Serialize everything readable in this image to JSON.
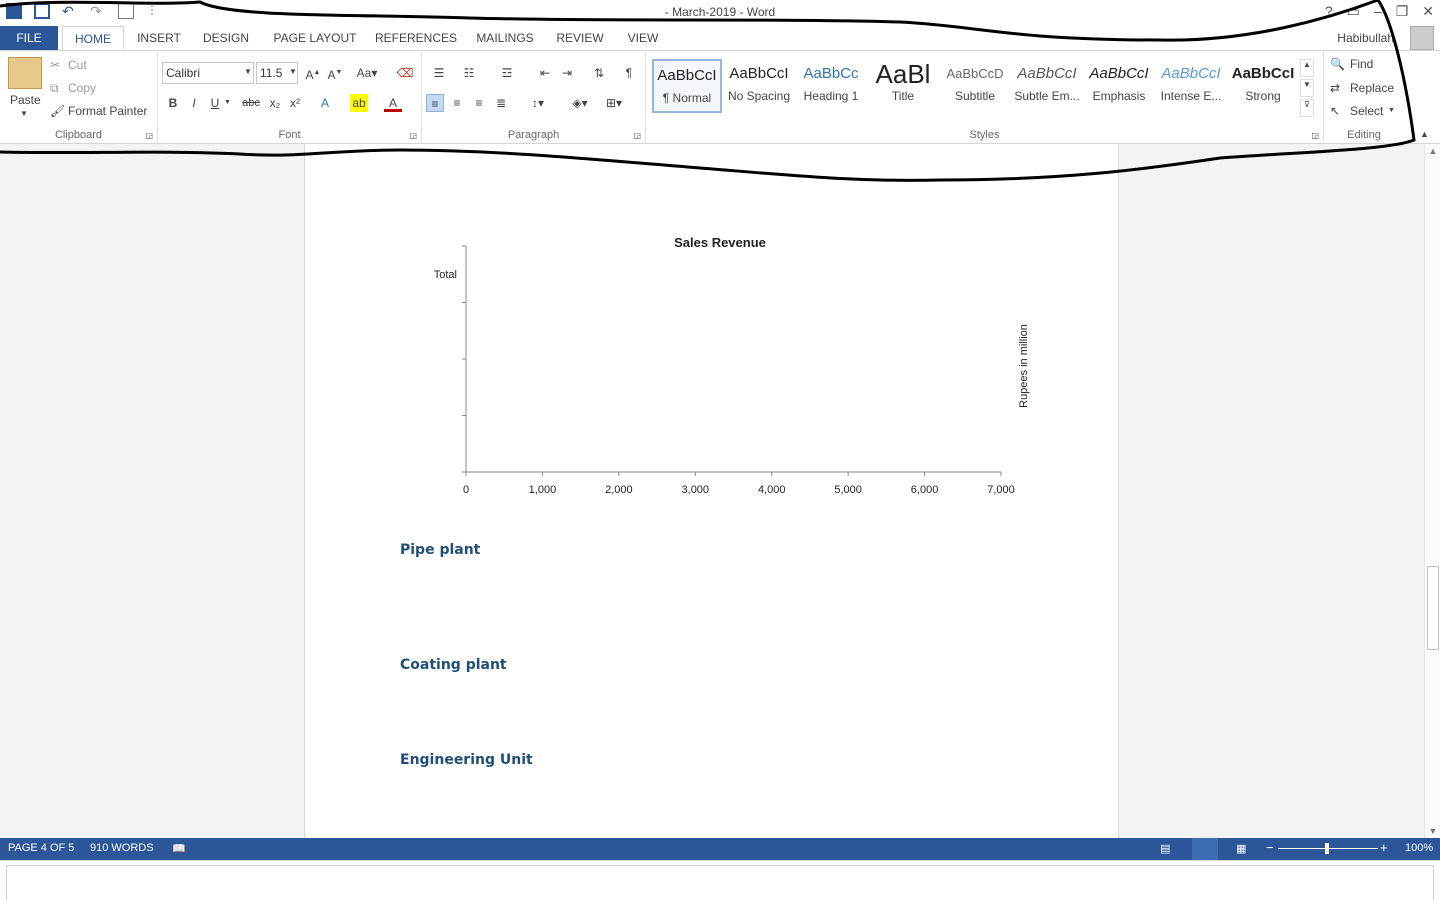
{
  "window": {
    "title": "- March-2019 - Word",
    "help": "?",
    "close": "✕"
  },
  "tabs": {
    "file": "FILE",
    "items": [
      "HOME",
      "INSERT",
      "DESIGN",
      "PAGE LAYOUT",
      "REFERENCES",
      "MAILINGS",
      "REVIEW",
      "VIEW"
    ],
    "active": "HOME",
    "user": "Habibullah"
  },
  "ribbon": {
    "clipboard": {
      "label": "Clipboard",
      "paste": "Paste",
      "cut": "Cut",
      "copy": "Copy",
      "format_painter": "Format Painter"
    },
    "font": {
      "label": "Font",
      "family": "Calibri",
      "size": "11.5",
      "bold": "B",
      "italic": "I",
      "underline": "U",
      "strike": "abc"
    },
    "paragraph": {
      "label": "Paragraph",
      "pilcrow": "¶"
    },
    "styles": {
      "label": "Styles",
      "items": [
        {
          "preview": "AaBbCcI",
          "name": "¶ Normal"
        },
        {
          "preview": "AaBbCcI",
          "name": "No Spacing"
        },
        {
          "preview": "AaBbCc",
          "name": "Heading 1"
        },
        {
          "preview": "AaBl",
          "name": "Title"
        },
        {
          "preview": "AaBbCcD",
          "name": "Subtitle"
        },
        {
          "preview": "AaBbCcI",
          "name": "Subtle Em..."
        },
        {
          "preview": "AaBbCcI",
          "name": "Emphasis"
        },
        {
          "preview": "AaBbCcI",
          "name": "Intense E..."
        },
        {
          "preview": "AaBbCcI",
          "name": "Strong"
        }
      ],
      "selected_index": 0,
      "colors": {
        "heading1": "#2e74b5",
        "intense": "#5b9bd5"
      }
    },
    "editing": {
      "label": "Editing",
      "find": "Find",
      "replace": "Replace",
      "select": "Select"
    }
  },
  "document": {
    "headings": [
      "Pipe plant",
      "Coating plant",
      "Engineering Unit"
    ],
    "heading_color": "#1f4e79"
  },
  "chart_data": {
    "type": "bar",
    "title": "Sales Revenue",
    "categories": [
      "Total"
    ],
    "series": [],
    "xlabel": "",
    "ylabel": "Rupees in million",
    "xlim": [
      0,
      7000
    ],
    "xticks": [
      "0",
      "1,000",
      "2,000",
      "3,000",
      "4,000",
      "5,000",
      "6,000",
      "7,000"
    ],
    "orientation": "horizontal",
    "grid": false
  },
  "statusbar": {
    "page": "PAGE 4 OF 5",
    "words": "910 WORDS",
    "zoom": "100%",
    "zoom_minus": "−",
    "zoom_plus": "+"
  }
}
